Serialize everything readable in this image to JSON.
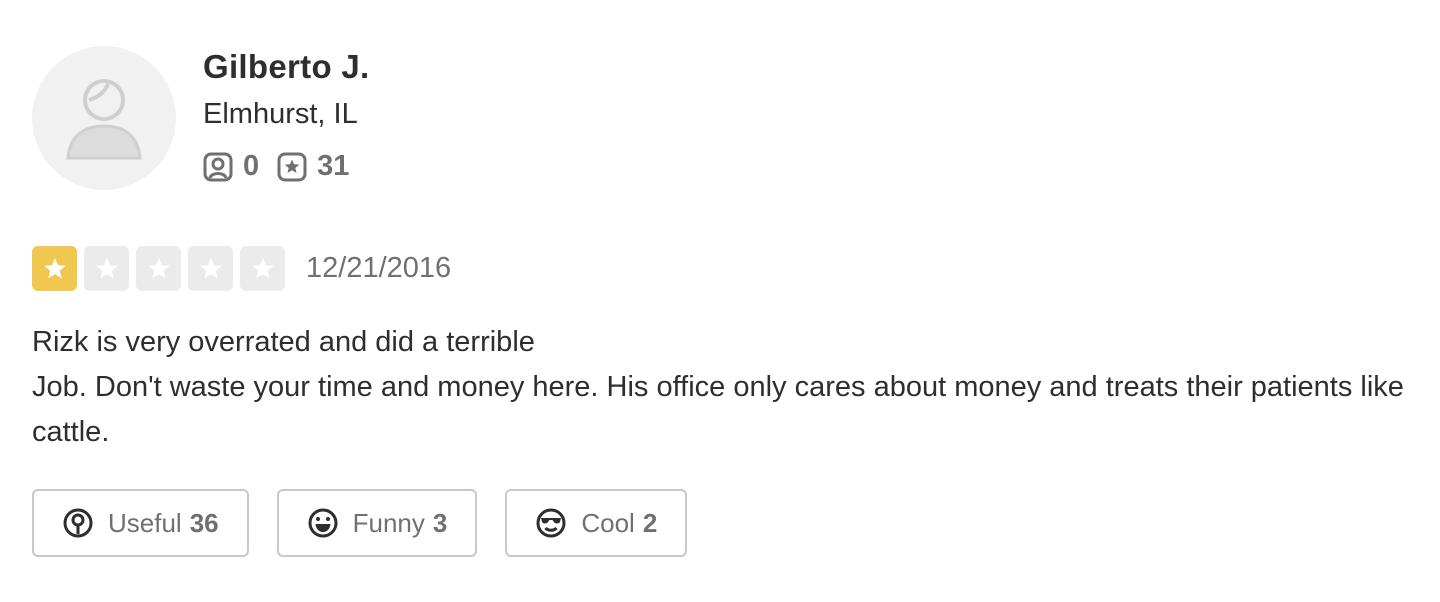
{
  "user": {
    "name": "Gilberto J.",
    "location": "Elmhurst, IL",
    "friends_count": "0",
    "reviews_count": "31"
  },
  "review": {
    "rating": 1,
    "max_rating": 5,
    "date": "12/21/2016",
    "lines": [
      "Rizk is very overrated and did a terrible",
      "Job. Don't waste your time and money here. His office only cares about money and treats their patients like cattle."
    ]
  },
  "reactions": {
    "useful": {
      "label": "Useful",
      "count": "36"
    },
    "funny": {
      "label": "Funny",
      "count": "3"
    },
    "cool": {
      "label": "Cool",
      "count": "2"
    }
  },
  "colors": {
    "star_filled": "#f0c850",
    "star_empty": "#ebebeb",
    "text_primary": "#2d2e2f",
    "text_secondary": "#6e7072",
    "button_border": "#c8c9ca"
  }
}
